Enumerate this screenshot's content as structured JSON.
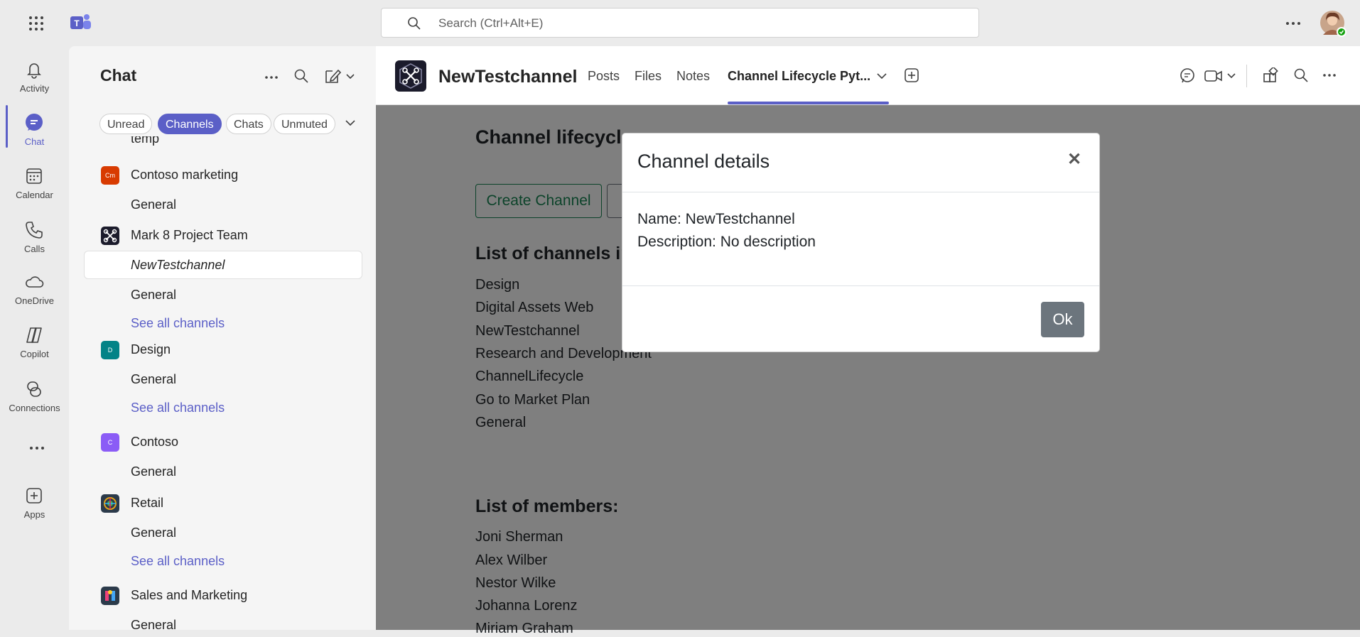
{
  "topbar": {
    "search_placeholder": "Search (Ctrl+Alt+E)"
  },
  "rail": [
    {
      "label": "Activity"
    },
    {
      "label": "Chat"
    },
    {
      "label": "Calendar"
    },
    {
      "label": "Calls"
    },
    {
      "label": "OneDrive"
    },
    {
      "label": "Copilot"
    },
    {
      "label": "Connections"
    },
    {
      "label": "Apps"
    }
  ],
  "chatpane": {
    "title": "Chat",
    "filters": [
      "Unread",
      "Channels",
      "Chats",
      "Unmuted"
    ],
    "items": {
      "temp": "temp",
      "contoso_marketing": "Contoso marketing",
      "contoso_marketing_icon": "Cm",
      "general1": "General",
      "mark8": "Mark 8 Project Team",
      "newtestchannel": "NewTestchannel",
      "general2": "General",
      "seeall1": "See all channels",
      "design": "Design",
      "design_icon": "D",
      "general3": "General",
      "seeall2": "See all channels",
      "contoso": "Contoso",
      "contoso_icon": "C",
      "general4": "General",
      "retail": "Retail",
      "general5": "General",
      "seeall3": "See all channels",
      "sales": "Sales and Marketing",
      "general6": "General"
    }
  },
  "header": {
    "channel_name": "NewTestchannel",
    "tabs": [
      "Posts",
      "Files",
      "Notes",
      "Channel Lifecycle Pyt..."
    ]
  },
  "content": {
    "heading": "Channel lifecycle",
    "create_button": "Create Channel",
    "channels_heading": "List of channels in",
    "channels": [
      "Design",
      "Digital Assets Web",
      "NewTestchannel",
      "Research and Development",
      "ChannelLifecycle",
      "Go to Market Plan",
      "General"
    ],
    "members_heading": "List of members:",
    "members": [
      "Joni Sherman",
      "Alex Wilber",
      "Nestor Wilke",
      "Johanna Lorenz",
      "Miriam Graham"
    ]
  },
  "modal": {
    "title": "Channel details",
    "name_line": "Name: NewTestchannel",
    "description_line": "Description: No description",
    "ok_label": "Ok"
  },
  "colors": {
    "accent": "#5b5fc7",
    "overlay": "rgba(0,0,0,0.5)",
    "ok_button": "#6c757d",
    "create_button": "#198754"
  }
}
